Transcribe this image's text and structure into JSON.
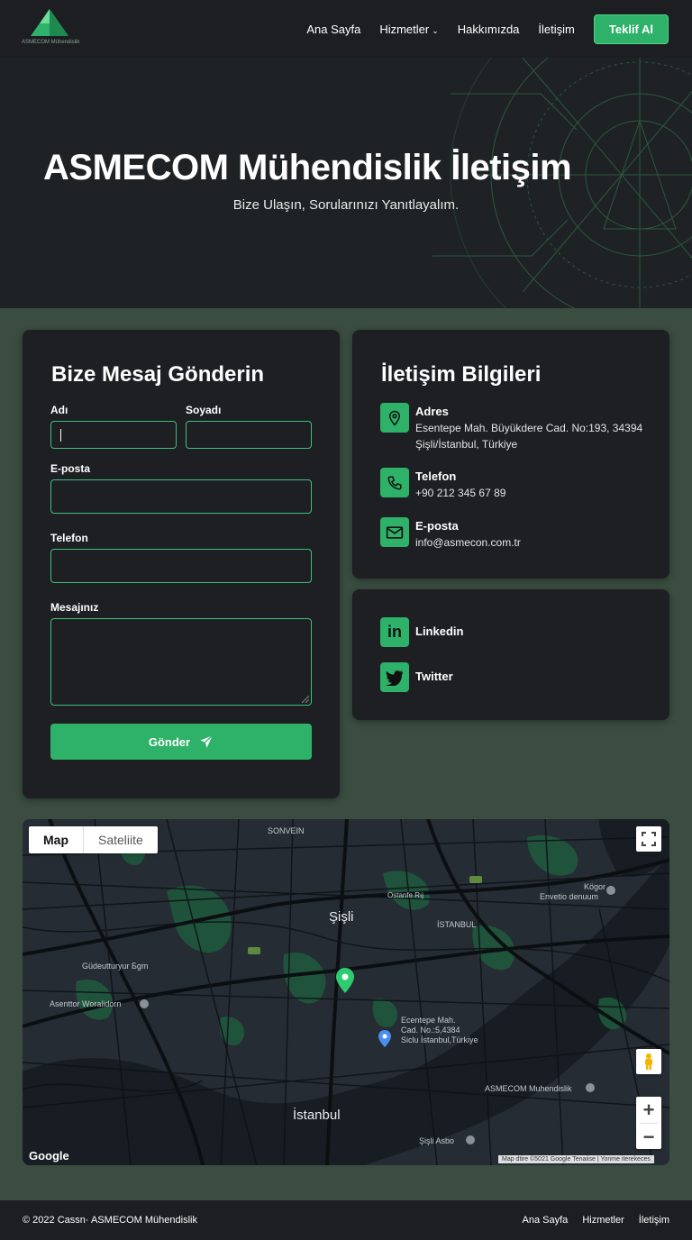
{
  "brand": {
    "logo_text": "ASMECOM Mühendislik",
    "accent": "#2eb169"
  },
  "nav": {
    "items": [
      "Ana Sayfa",
      "Hizmetler",
      "Hakkımızda",
      "İletişim"
    ],
    "cta": "Teklif Al"
  },
  "hero": {
    "title": "ASMECOM Mühendislik İletişim",
    "subtitle": "Bize Ulaşın, Sorularınızı Yanıtlayalım."
  },
  "form": {
    "title": "Bize Mesaj Gönderin",
    "first_name_label": "Adı",
    "last_name_label": "Soyadı",
    "email_label": "E-posta",
    "phone_label": "Telefon",
    "message_label": "Mesajınız",
    "submit_label": "Gönder"
  },
  "contact": {
    "title": "İletişim Bilgileri",
    "address_label": "Adres",
    "address_line1": "Esentepe Mah. Büyükdere Cad. No:193, 34394",
    "address_line2": "Şişli/İstanbul, Türkiye",
    "phone_label": "Telefon",
    "phone": "+90 212 345 67 89",
    "email_label": "E-posta",
    "email": "info@asmecon.com.tr"
  },
  "social": {
    "linkedin": "Linkedin",
    "twitter": "Twitter"
  },
  "map": {
    "tab_map": "Map",
    "tab_satellite": "Sateliite",
    "labels": {
      "sisli": "Şişli",
      "istanbul": "İstanbul",
      "istanbul_upper": "İSTANBUL",
      "sonvein": "SONVEIN",
      "gudeutt": "Güdeutturyur Бgm",
      "asenter": "Asenttor Woralidorn",
      "esentepe1": "Ecentepe Mah.",
      "esentepe2": "Cad. No.:5,4384",
      "esentepe3": "Siclu İstanbul,Türkiye",
      "asmecom": "ASMECOM Muhendislik",
      "sisli_asbo": "Şişli Asbo",
      "kogor1": "Kögor",
      "kogor2": "Envetio denuum",
      "ostanfe": "Ostanfe Rıj"
    },
    "google": "Google",
    "attribution": "Map dtire ©5021 Google Tenaiise | Yonme iterekeces"
  },
  "footer": {
    "copyright": "© 2022 Cassn·  ASMECOM Mühendislik",
    "links": [
      "Ana Sayfa",
      "Hizmetler",
      "İletişim"
    ]
  }
}
